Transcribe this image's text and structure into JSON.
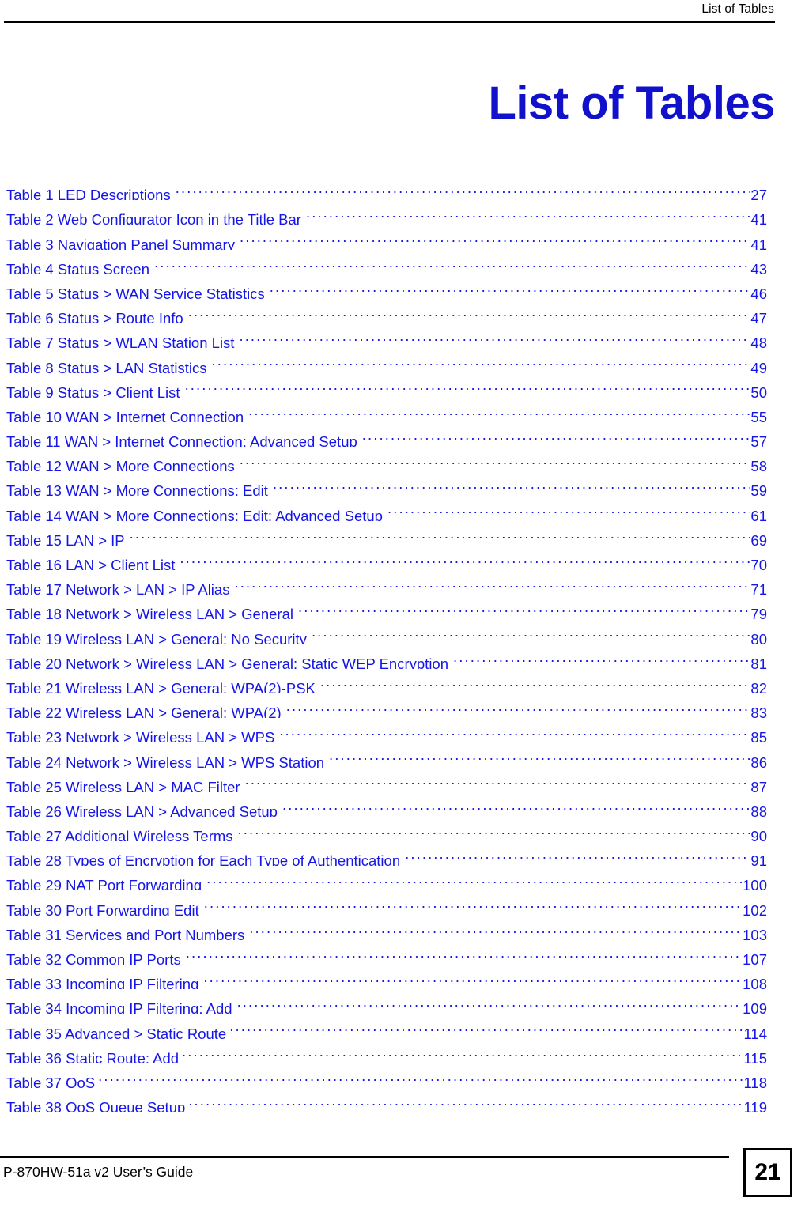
{
  "header": {
    "running_title": "List of Tables"
  },
  "title": "List of Tables",
  "toc": {
    "entries": [
      {
        "label": "Table 1 LED Descriptions",
        "page": "27",
        "tight": false
      },
      {
        "label": "Table 2 Web Configurator Icon in the Title Bar",
        "page": "41",
        "tight": false
      },
      {
        "label": "Table 3 Navigation Panel Summary",
        "page": "41",
        "tight": false
      },
      {
        "label": "Table 4 Status Screen",
        "page": "43",
        "tight": false
      },
      {
        "label": "Table 5 Status > WAN Service Statistics",
        "page": "46",
        "tight": false
      },
      {
        "label": "Table 6 Status > Route Info",
        "page": "47",
        "tight": false
      },
      {
        "label": "Table 7 Status > WLAN Station List",
        "page": "48",
        "tight": false
      },
      {
        "label": "Table 8 Status > LAN Statistics",
        "page": "49",
        "tight": false
      },
      {
        "label": "Table 9 Status > Client List",
        "page": "50",
        "tight": false
      },
      {
        "label": "Table 10 WAN > Internet Connection",
        "page": "55",
        "tight": false
      },
      {
        "label": "Table 11 WAN > Internet Connection: Advanced Setup",
        "page": "57",
        "tight": false
      },
      {
        "label": "Table 12 WAN > More Connections",
        "page": "58",
        "tight": false
      },
      {
        "label": "Table 13 WAN > More Connections: Edit",
        "page": "59",
        "tight": false
      },
      {
        "label": "Table 14 WAN > More Connections: Edit: Advanced Setup",
        "page": "61",
        "tight": false
      },
      {
        "label": "Table 15 LAN > IP",
        "page": "69",
        "tight": false
      },
      {
        "label": "Table 16 LAN > Client List",
        "page": "70",
        "tight": false
      },
      {
        "label": "Table 17 Network > LAN > IP Alias",
        "page": "71",
        "tight": false
      },
      {
        "label": "Table 18 Network > Wireless LAN > General",
        "page": "79",
        "tight": false
      },
      {
        "label": "Table 19 Wireless LAN > General: No Security",
        "page": "80",
        "tight": false
      },
      {
        "label": "Table 20 Network > Wireless LAN > General: Static WEP Encryption",
        "page": "81",
        "tight": false
      },
      {
        "label": "Table 21 Wireless LAN > General: WPA(2)-PSK",
        "page": "82",
        "tight": false
      },
      {
        "label": "Table 22 Wireless LAN > General: WPA(2)",
        "page": "83",
        "tight": false
      },
      {
        "label": "Table 23 Network > Wireless LAN > WPS",
        "page": "85",
        "tight": false
      },
      {
        "label": "Table 24 Network > Wireless LAN > WPS Station",
        "page": "86",
        "tight": false
      },
      {
        "label": "Table 25 Wireless LAN > MAC Filter",
        "page": "87",
        "tight": false
      },
      {
        "label": "Table 26 Wireless LAN > Advanced Setup",
        "page": "88",
        "tight": false
      },
      {
        "label": "Table 27 Additional Wireless Terms",
        "page": "90",
        "tight": false
      },
      {
        "label": "Table 28 Types of Encryption for Each Type of Authentication",
        "page": "91",
        "tight": false
      },
      {
        "label": "Table 29 NAT Port Forwarding",
        "page": "100",
        "tight": false
      },
      {
        "label": "Table 30 Port Forwarding Edit",
        "page": "102",
        "tight": false
      },
      {
        "label": "Table 31 Services and Port Numbers",
        "page": "103",
        "tight": false
      },
      {
        "label": "Table 32 Common IP Ports",
        "page": "107",
        "tight": false
      },
      {
        "label": "Table 33 Incoming IP Filtering",
        "page": "108",
        "tight": false
      },
      {
        "label": "Table 34 Incoming IP Filtering: Add",
        "page": "109",
        "tight": false
      },
      {
        "label": "Table 35 Advanced > Static Route",
        "page": "114",
        "tight": true
      },
      {
        "label": "Table 36 Static Route: Add",
        "page": "115",
        "tight": true
      },
      {
        "label": "Table 37 QoS",
        "page": "118",
        "tight": true
      },
      {
        "label": "Table 38 QoS Queue Setup",
        "page": "119",
        "tight": true
      }
    ]
  },
  "footer": {
    "guide_text": "P-870HW-51a v2 User’s Guide",
    "page_number": "21"
  },
  "colors": {
    "toc_blue": "#1515e8",
    "title_blue": "#1111cc",
    "rule_black": "#000000"
  }
}
